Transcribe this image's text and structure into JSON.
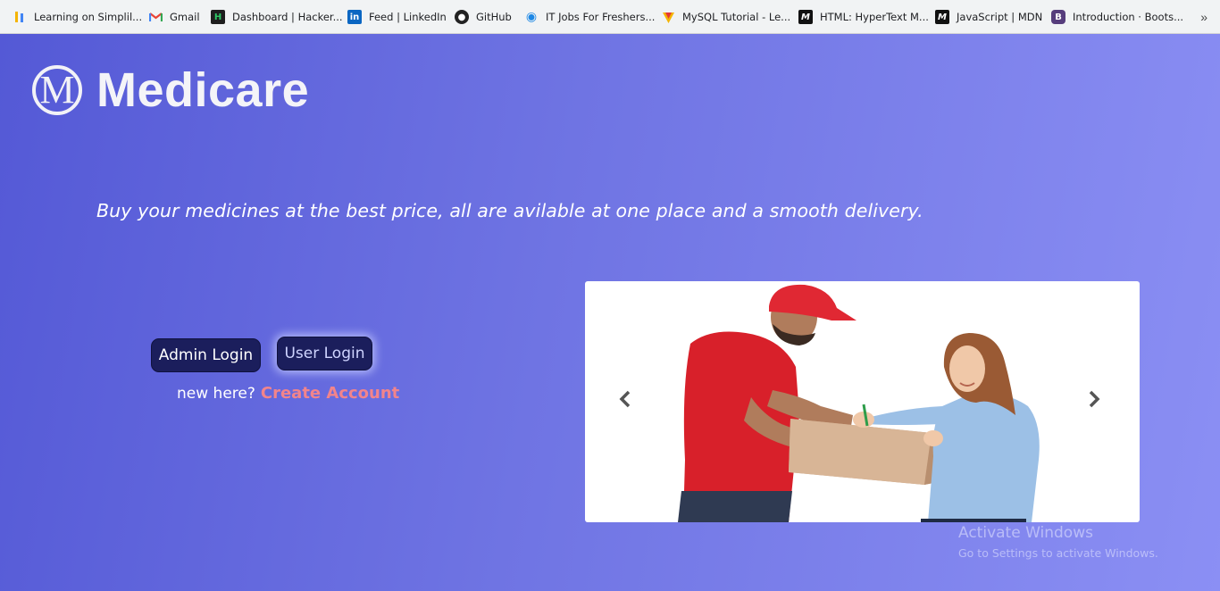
{
  "bookmarks": {
    "items": [
      {
        "label": "Learning on Simplil...",
        "icon": "simplilearn-icon"
      },
      {
        "label": "Gmail",
        "icon": "gmail-icon"
      },
      {
        "label": "Dashboard | Hacker...",
        "icon": "hackerrank-icon"
      },
      {
        "label": "Feed | LinkedIn",
        "icon": "linkedin-icon"
      },
      {
        "label": "GitHub",
        "icon": "github-icon"
      },
      {
        "label": "IT Jobs For Freshers...",
        "icon": "jobs-icon"
      },
      {
        "label": "MySQL Tutorial - Le...",
        "icon": "mysql-tutorial-icon"
      },
      {
        "label": "HTML: HyperText M...",
        "icon": "mdn-icon"
      },
      {
        "label": "JavaScript | MDN",
        "icon": "mdn-icon"
      },
      {
        "label": "Introduction · Boots...",
        "icon": "bootstrap-icon"
      }
    ],
    "more": "»"
  },
  "header": {
    "logo_mark": "M",
    "logo_text": "Medicare"
  },
  "hero": {
    "tagline": "Buy your medicines at the best price, all are avilable at one place and a smooth delivery."
  },
  "auth": {
    "admin_login": "Admin Login",
    "user_login": "User Login",
    "new_here": "new here?",
    "create_account": "Create Account"
  },
  "carousel": {
    "image": "delivery-man-handing-box-to-woman",
    "prev": "‹",
    "next": "›"
  },
  "watermark": {
    "line1": "Activate Windows",
    "line2": "Go to Settings to activate Windows."
  },
  "colors": {
    "accent_link": "#f2848b",
    "button_bg": "#1b1e5c",
    "gradient_start": "#5459d6",
    "gradient_end": "#8b8ff4"
  }
}
